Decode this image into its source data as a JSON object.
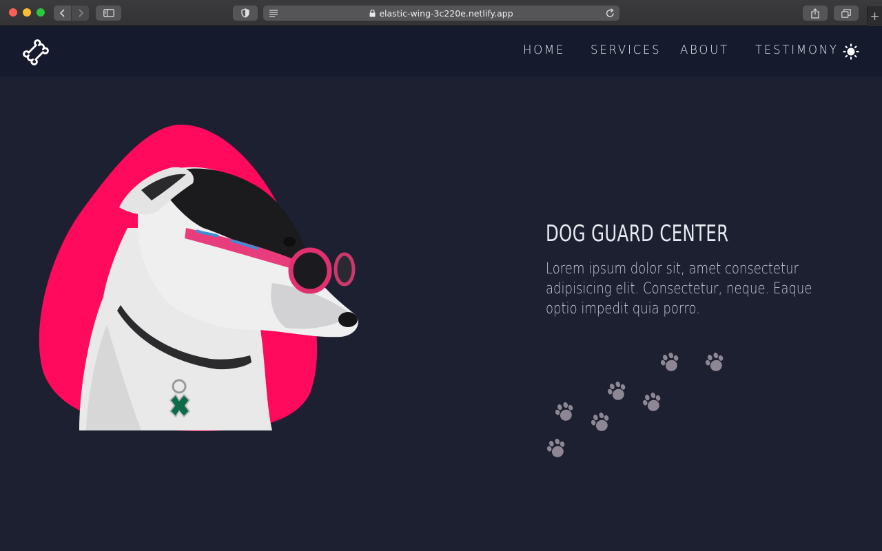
{
  "browser": {
    "url": "elastic-wing-3c220e.netlify.app",
    "icons": [
      "back-icon",
      "forward-icon",
      "sidebar-icon",
      "shield-icon",
      "reader-icon",
      "lock-icon",
      "reload-icon",
      "share-icon",
      "tabs-icon",
      "plus-icon"
    ]
  },
  "nav": {
    "logo": "bone-icon",
    "links": [
      "HOME",
      "SERVICES",
      "ABOUT",
      "TESTIMONY"
    ],
    "theme_icon": "sun-icon"
  },
  "hero": {
    "title": "DOG GUARD CENTER",
    "text": "Lorem ipsum dolor sit, amet consectetur adipisicing elit. Consectetur, neque. Eaque optio impedit quia porro.",
    "image": "dog-with-sunglasses",
    "decoration": "paw-prints-icon"
  },
  "colors": {
    "navbar": "#151a2d",
    "background": "#1d2030",
    "blob": "#ff0a5c",
    "paw": "#8d8795",
    "text": "#e9ebf2"
  }
}
